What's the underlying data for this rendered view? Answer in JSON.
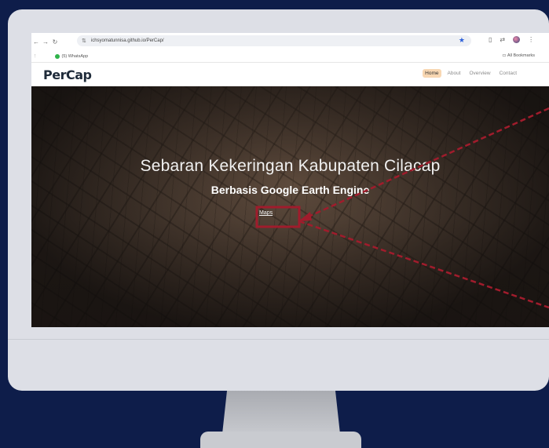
{
  "browser": {
    "url": "ichsyomatunnisa.github.io/PerCap/",
    "bookmark_item": "(5) WhatsApp",
    "all_bookmarks": "All Bookmarks"
  },
  "site": {
    "logo": "PerCap",
    "menu": [
      {
        "label": "Home"
      },
      {
        "label": "About"
      },
      {
        "label": "Overview"
      },
      {
        "label": "Contact"
      }
    ]
  },
  "hero": {
    "title": "Sebaran Kekeringan Kabupaten Cilacap",
    "subtitle": "Berbasis Google Earth Engine",
    "link": "Maps"
  },
  "colors": {
    "background": "#0e1d4a",
    "annotation": "#a01c2c",
    "active_menu": "#f8d7b2"
  }
}
